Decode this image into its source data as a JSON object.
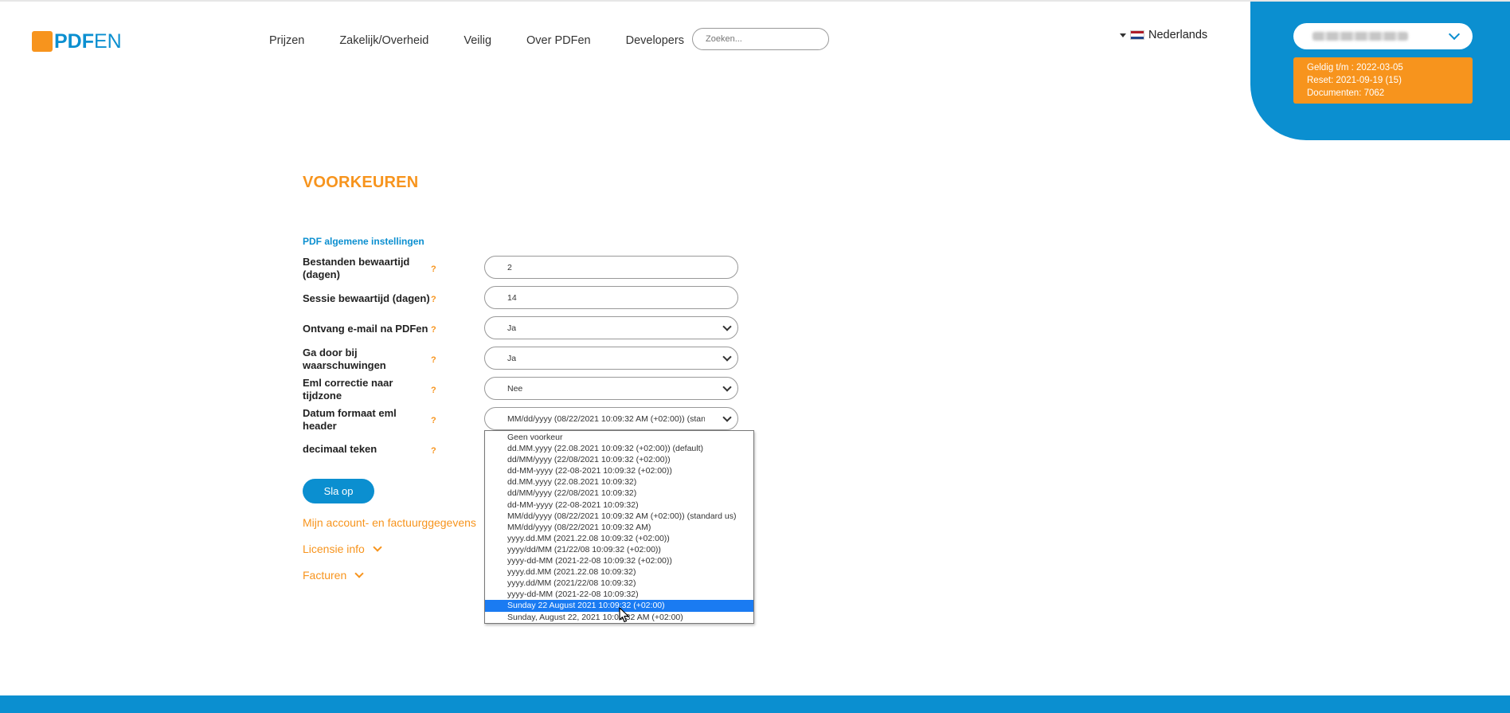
{
  "header": {
    "logo": {
      "part1": "PDF",
      "part2": "EN"
    },
    "nav": [
      "Prijzen",
      "Zakelijk/Overheid",
      "Veilig",
      "Over PDFen",
      "Developers"
    ],
    "search_placeholder": "Zoeken...",
    "language": "Nederlands"
  },
  "account": {
    "valid_until": "Geldig t/m : 2022-03-05",
    "reset": "Reset: 2021-09-19 (15)",
    "documents": "Documenten: 7062"
  },
  "page": {
    "title": "VOORKEUREN",
    "section": "PDF algemene instellingen"
  },
  "settings": [
    {
      "label": "Bestanden bewaartijd (dagen)",
      "value": "2"
    },
    {
      "label": "Sessie bewaartijd (dagen)",
      "value": "14"
    },
    {
      "label": "Ontvang e-mail na PDFen",
      "value": "Ja"
    },
    {
      "label": "Ga door bij waarschuwingen",
      "value": "Ja"
    },
    {
      "label": "Eml correctie naar tijdzone",
      "value": "Nee"
    },
    {
      "label": "Datum formaat eml header",
      "value": "MM/dd/yyyy (08/22/2021 10:09:32 AM (+02:00)) (standard us)"
    },
    {
      "label": "decimaal teken"
    }
  ],
  "help_mark": "?",
  "date_options": [
    "Geen voorkeur",
    "dd.MM.yyyy (22.08.2021 10:09:32 (+02:00)) (default)",
    "dd/MM/yyyy (22/08/2021 10:09:32 (+02:00))",
    "dd-MM-yyyy (22-08-2021 10:09:32 (+02:00))",
    "dd.MM.yyyy (22.08.2021 10:09:32)",
    "dd/MM/yyyy (22/08/2021 10:09:32)",
    "dd-MM-yyyy (22-08-2021 10:09:32)",
    "MM/dd/yyyy (08/22/2021 10:09:32 AM (+02:00)) (standard us)",
    "MM/dd/yyyy (08/22/2021 10:09:32 AM)",
    "yyyy.dd.MM (2021.22.08 10:09:32 (+02:00))",
    "yyyy/dd/MM (21/22/08 10:09:32 (+02:00))",
    "yyyy-dd-MM (2021-22-08 10:09:32 (+02:00))",
    "yyyy.dd.MM (2021.22.08 10:09:32)",
    "yyyy.dd/MM (2021/22/08 10:09:32)",
    "yyyy-dd-MM (2021-22-08 10:09:32)",
    "Sunday 22 August 2021 10:09:32 (+02:00)",
    "Sunday, August 22, 2021 10:09:32 AM (+02:00)"
  ],
  "selected_option": "Sunday 22 August 2021 10:09:32 (+02:00)",
  "actions": {
    "save": "Sla op",
    "account_link": "Mijn account- en factuurggegevens",
    "license": "Licensie info",
    "invoices": "Facturen"
  },
  "colors": {
    "blue": "#0b8fd0",
    "orange": "#f7941d",
    "highlight": "#1a7bf2"
  },
  "icons": [
    "chevron-down-icon",
    "caret-down-icon",
    "netherlands-flag-icon",
    "help-icon",
    "mouse-cursor-icon"
  ]
}
